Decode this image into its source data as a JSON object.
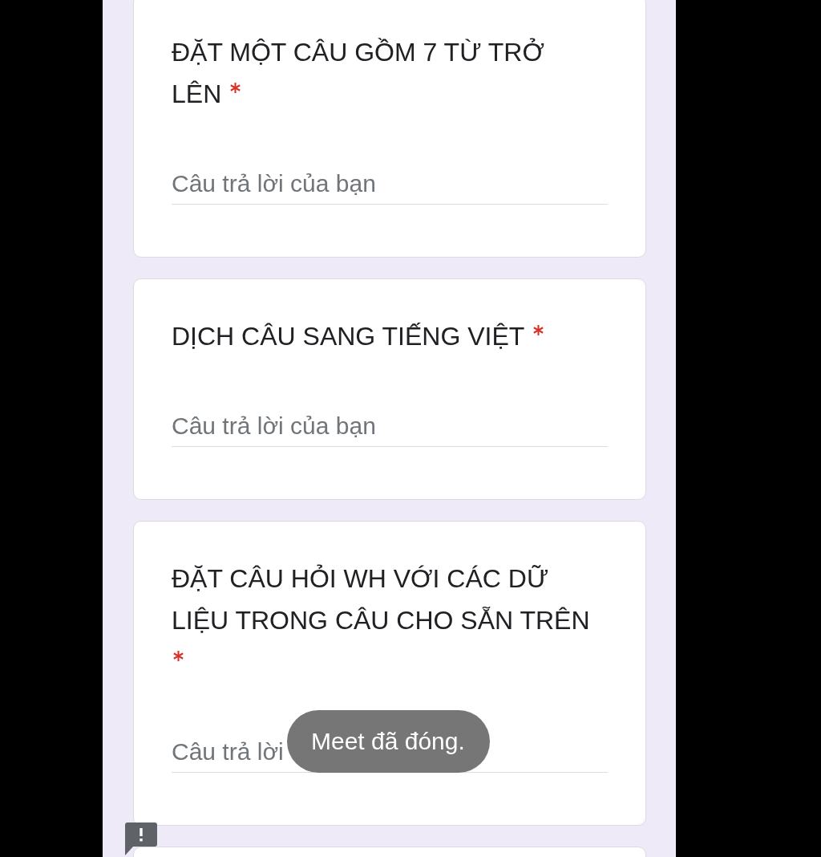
{
  "questions": [
    {
      "title": "ĐẶT MỘT CÂU GỒM 7 TỪ TRỞ LÊN",
      "required": true,
      "placeholder": "Câu trả lời của bạn"
    },
    {
      "title": "DỊCH CÂU SANG TIẾNG VIỆT",
      "required": true,
      "placeholder": "Câu trả lời của bạn"
    },
    {
      "title": "ĐẶT CÂU HỎI WH VỚI CÁC DỮ LIỆU TRONG CÂU CHO SẴN TRÊN",
      "required": true,
      "placeholder": "Câu trả lời"
    }
  ],
  "toast": {
    "text": "Meet đã đóng."
  }
}
